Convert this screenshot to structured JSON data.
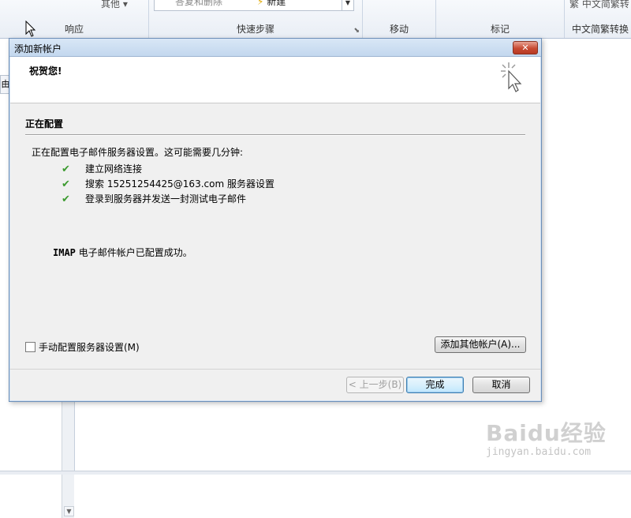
{
  "ribbon": {
    "top_fragment_1": "",
    "other_label": "其他",
    "quickstep_item_1": "答复和删除",
    "quickstep_item_2": "新建",
    "groups": {
      "respond": "响应",
      "quicksteps": "快速步骤",
      "move": "移动",
      "tags": "标记",
      "chinese_conversion": "中文简繁转换"
    },
    "conversion_button": "中文简繁转"
  },
  "left_pane": {
    "tab_label": "由"
  },
  "dialog": {
    "title": "添加新帐户",
    "close_label": "✕",
    "banner_heading": "祝贺您!",
    "section_title": "正在配置",
    "intro": "正在配置电子邮件服务器设置。这可能需要几分钟:",
    "steps": [
      {
        "text": "建立网络连接"
      },
      {
        "text": "搜索 15251254425@163.com 服务器设置"
      },
      {
        "text": "登录到服务器并发送一封测试电子邮件"
      }
    ],
    "success_prefix": "IMAP",
    "success_text": " 电子邮件帐户已配置成功。",
    "manual_checkbox_label": "手动配置服务器设置(M)",
    "add_other_button": "添加其他帐户(A)...",
    "back_button": "< 上一步(B)",
    "finish_button": "完成",
    "cancel_button": "取消"
  },
  "watermark": {
    "line1": "Baidu经验",
    "line2": "jingyan.baidu.com"
  },
  "colors": {
    "check": "#3c9b2f",
    "close": "#c84a33",
    "titlebar": "#c3d7ee"
  }
}
